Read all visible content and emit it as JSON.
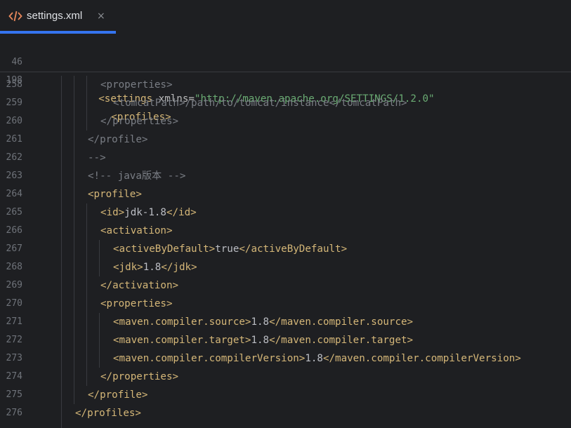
{
  "tab": {
    "title": "settings.xml",
    "icon": "xml-code-icon",
    "close_glyph": "×",
    "accent_color": "#3574f0"
  },
  "sticky_lines": [
    {
      "num": "46",
      "pre": "<settings",
      "attr": " xmlns=",
      "str": "\"http://maven.apache.org/SETTINGS/1.2.0\""
    },
    {
      "num": "198",
      "tag": "<profiles>"
    }
  ],
  "lines": [
    {
      "num": "258",
      "parts": [
        {
          "c": "cmt",
          "t": "<properties>"
        }
      ]
    },
    {
      "num": "259",
      "parts": [
        {
          "c": "cmt",
          "t": "<tomcatPath>/path/to/tomcat/instance</tomcatPath>"
        }
      ]
    },
    {
      "num": "260",
      "parts": [
        {
          "c": "cmt",
          "t": "</properties>"
        }
      ]
    },
    {
      "num": "261",
      "parts": [
        {
          "c": "cmt",
          "t": "</profile>"
        }
      ]
    },
    {
      "num": "262",
      "parts": [
        {
          "c": "cmt",
          "t": "-->"
        }
      ]
    },
    {
      "num": "263",
      "parts": [
        {
          "c": "cmt",
          "t": "<!-- java版本 -->"
        }
      ]
    },
    {
      "num": "264",
      "parts": [
        {
          "c": "tag",
          "t": "<profile>"
        }
      ]
    },
    {
      "num": "265",
      "parts": [
        {
          "c": "tag",
          "t": "<id>"
        },
        {
          "c": "txt",
          "t": "jdk-1.8"
        },
        {
          "c": "tag",
          "t": "</id>"
        }
      ]
    },
    {
      "num": "266",
      "parts": [
        {
          "c": "tag",
          "t": "<activation>"
        }
      ]
    },
    {
      "num": "267",
      "parts": [
        {
          "c": "tag",
          "t": "<activeByDefault>"
        },
        {
          "c": "txt",
          "t": "true"
        },
        {
          "c": "tag",
          "t": "</activeByDefault>"
        }
      ]
    },
    {
      "num": "268",
      "parts": [
        {
          "c": "tag",
          "t": "<jdk>"
        },
        {
          "c": "txt",
          "t": "1.8"
        },
        {
          "c": "tag",
          "t": "</jdk>"
        }
      ]
    },
    {
      "num": "269",
      "parts": [
        {
          "c": "tag",
          "t": "</activation>"
        }
      ]
    },
    {
      "num": "270",
      "parts": [
        {
          "c": "tag",
          "t": "<properties>"
        }
      ]
    },
    {
      "num": "271",
      "parts": [
        {
          "c": "tag",
          "t": "<maven.compiler.source>"
        },
        {
          "c": "txt",
          "t": "1.8"
        },
        {
          "c": "tag",
          "t": "</maven.compiler.source>"
        }
      ]
    },
    {
      "num": "272",
      "parts": [
        {
          "c": "tag",
          "t": "<maven.compiler.target>"
        },
        {
          "c": "txt",
          "t": "1.8"
        },
        {
          "c": "tag",
          "t": "</maven.compiler.target>"
        }
      ]
    },
    {
      "num": "273",
      "parts": [
        {
          "c": "tag",
          "t": "<maven.compiler.compilerVersion>"
        },
        {
          "c": "txt",
          "t": "1.8"
        },
        {
          "c": "tag",
          "t": "</maven.compiler.compilerVersion>"
        }
      ]
    },
    {
      "num": "274",
      "parts": [
        {
          "c": "tag",
          "t": "</properties>"
        }
      ]
    },
    {
      "num": "275",
      "parts": [
        {
          "c": "tag",
          "t": "</profile>"
        }
      ]
    },
    {
      "num": "276",
      "parts": [
        {
          "c": "tag",
          "t": "</profiles>"
        }
      ]
    }
  ]
}
